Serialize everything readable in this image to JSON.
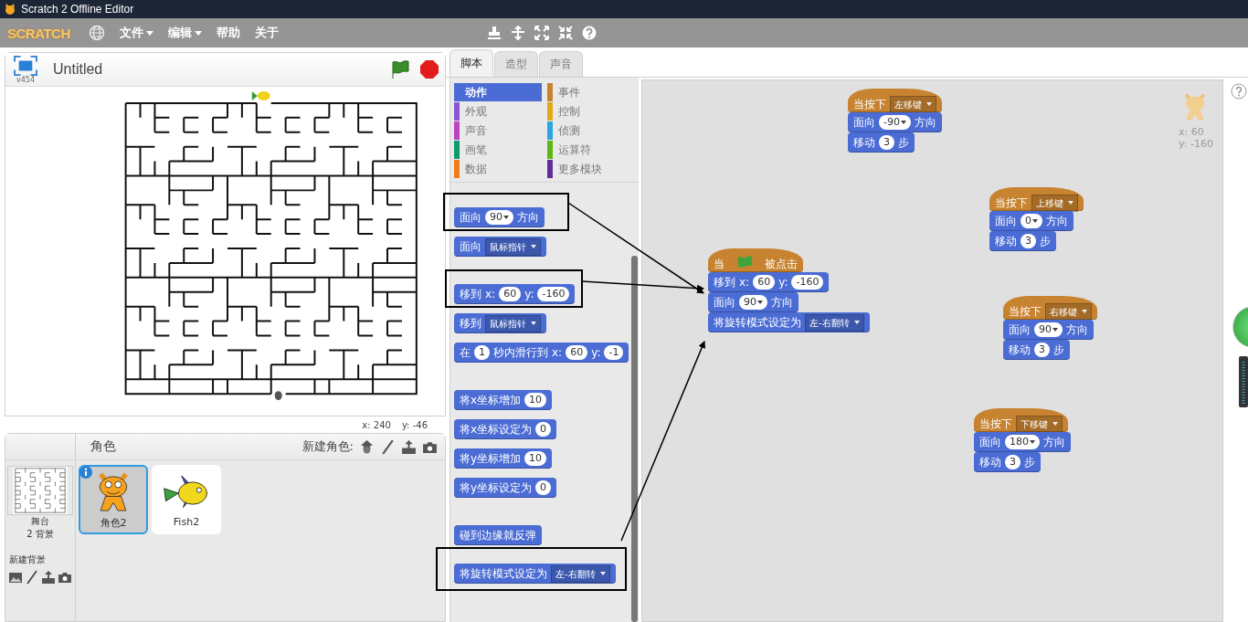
{
  "window": {
    "title": "Scratch 2 Offline Editor"
  },
  "menu": {
    "logo": "SCRATCH",
    "items": [
      {
        "label": "文件",
        "dropdown": true
      },
      {
        "label": "编辑",
        "dropdown": true
      },
      {
        "label": "帮助",
        "dropdown": false
      },
      {
        "label": "关于",
        "dropdown": false
      }
    ]
  },
  "stage": {
    "title": "Untitled",
    "version": "v454",
    "mouse_x": "x: 240",
    "mouse_y": "y: -46"
  },
  "sprites_panel": {
    "title": "角色",
    "new_sprite_label": "新建角色:",
    "stage_label": "舞台",
    "backdrop_count": "2 背景",
    "new_backdrop_label": "新建背景",
    "sprites": [
      {
        "name": "角色2",
        "kind": "cat",
        "selected": true
      },
      {
        "name": "Fish2",
        "kind": "fish",
        "selected": false
      }
    ]
  },
  "tabs": [
    {
      "label": "脚本",
      "selected": true
    },
    {
      "label": "造型",
      "selected": false
    },
    {
      "label": "声音",
      "selected": false
    }
  ],
  "categories": [
    {
      "label": "动作",
      "color": "#4a6cd4",
      "selected": true
    },
    {
      "label": "事件",
      "color": "#c88330",
      "selected": false
    },
    {
      "label": "外观",
      "color": "#8a55d7",
      "selected": false
    },
    {
      "label": "控制",
      "color": "#e1a91a",
      "selected": false
    },
    {
      "label": "声音",
      "color": "#bb42c3",
      "selected": false
    },
    {
      "label": "侦测",
      "color": "#2ca5e2",
      "selected": false
    },
    {
      "label": "画笔",
      "color": "#0e9a6c",
      "selected": false
    },
    {
      "label": "运算符",
      "color": "#5cb712",
      "selected": false
    },
    {
      "label": "数据",
      "color": "#ee7d16",
      "selected": false
    },
    {
      "label": "更多模块",
      "color": "#632d99",
      "selected": false
    }
  ],
  "palette_groups": [
    [
      {
        "color": "#4a6cd4",
        "kind": "stack",
        "parts": [
          {
            "kind": "text",
            "text": "面向"
          },
          {
            "kind": "number",
            "text": "90",
            "dropdown": true
          },
          {
            "kind": "text",
            "text": "方向"
          }
        ]
      },
      {
        "color": "#4a6cd4",
        "kind": "stack",
        "parts": [
          {
            "kind": "text",
            "text": "面向"
          },
          {
            "kind": "menu",
            "text": "鼠标指针"
          }
        ]
      }
    ],
    [
      {
        "color": "#4a6cd4",
        "kind": "stack",
        "parts": [
          {
            "kind": "text",
            "text": "移到"
          },
          {
            "kind": "text",
            "text": "x:"
          },
          {
            "kind": "number",
            "text": "60",
            "dropdown": false
          },
          {
            "kind": "text",
            "text": "y:"
          },
          {
            "kind": "number",
            "text": "-160",
            "dropdown": false
          }
        ]
      },
      {
        "color": "#4a6cd4",
        "kind": "stack",
        "parts": [
          {
            "kind": "text",
            "text": "移到"
          },
          {
            "kind": "menu",
            "text": "鼠标指针"
          }
        ]
      },
      {
        "color": "#4a6cd4",
        "kind": "stack",
        "parts": [
          {
            "kind": "text",
            "text": "在"
          },
          {
            "kind": "number",
            "text": "1",
            "dropdown": false
          },
          {
            "kind": "text",
            "text": "秒内滑行到"
          },
          {
            "kind": "text",
            "text": "x:"
          },
          {
            "kind": "number",
            "text": "60",
            "dropdown": false
          },
          {
            "kind": "text",
            "text": "y:"
          },
          {
            "kind": "number",
            "text": "-1",
            "dropdown": false
          }
        ]
      }
    ],
    [
      {
        "color": "#4a6cd4",
        "kind": "stack",
        "parts": [
          {
            "kind": "text",
            "text": "将x坐标增加"
          },
          {
            "kind": "number",
            "text": "10",
            "dropdown": false
          }
        ]
      },
      {
        "color": "#4a6cd4",
        "kind": "stack",
        "parts": [
          {
            "kind": "text",
            "text": "将x坐标设定为"
          },
          {
            "kind": "number",
            "text": "0",
            "dropdown": false
          }
        ]
      },
      {
        "color": "#4a6cd4",
        "kind": "stack",
        "parts": [
          {
            "kind": "text",
            "text": "将y坐标增加"
          },
          {
            "kind": "number",
            "text": "10",
            "dropdown": false
          }
        ]
      },
      {
        "color": "#4a6cd4",
        "kind": "stack",
        "parts": [
          {
            "kind": "text",
            "text": "将y坐标设定为"
          },
          {
            "kind": "number",
            "text": "0",
            "dropdown": false
          }
        ]
      }
    ],
    [
      {
        "color": "#4a6cd4",
        "kind": "stack",
        "parts": [
          {
            "kind": "text",
            "text": "碰到边缘就反弹"
          }
        ]
      }
    ],
    [
      {
        "color": "#4a6cd4",
        "kind": "stack",
        "parts": [
          {
            "kind": "text",
            "text": "将旋转模式设定为"
          },
          {
            "kind": "menu",
            "text": "左-右翻转"
          }
        ]
      }
    ]
  ],
  "scripts": [
    [
      {
        "color": "#c88330",
        "kind": "hat",
        "parts": [
          {
            "kind": "text",
            "text": "当按下"
          },
          {
            "kind": "menu",
            "text": "左移键"
          }
        ]
      },
      {
        "color": "#4a6cd4",
        "kind": "stack",
        "parts": [
          {
            "kind": "text",
            "text": "面向"
          },
          {
            "kind": "number",
            "text": "-90",
            "dropdown": true
          },
          {
            "kind": "text",
            "text": "方向"
          }
        ]
      },
      {
        "color": "#4a6cd4",
        "kind": "stack",
        "parts": [
          {
            "kind": "text",
            "text": "移动"
          },
          {
            "kind": "number",
            "text": "3",
            "dropdown": false
          },
          {
            "kind": "text",
            "text": "步"
          }
        ]
      }
    ],
    [
      {
        "color": "#c88330",
        "kind": "hat",
        "parts": [
          {
            "kind": "text",
            "text": "当按下"
          },
          {
            "kind": "menu",
            "text": "上移键"
          }
        ]
      },
      {
        "color": "#4a6cd4",
        "kind": "stack",
        "parts": [
          {
            "kind": "text",
            "text": "面向"
          },
          {
            "kind": "number",
            "text": "0",
            "dropdown": true
          },
          {
            "kind": "text",
            "text": "方向"
          }
        ]
      },
      {
        "color": "#4a6cd4",
        "kind": "stack",
        "parts": [
          {
            "kind": "text",
            "text": "移动"
          },
          {
            "kind": "number",
            "text": "3",
            "dropdown": false
          },
          {
            "kind": "text",
            "text": "步"
          }
        ]
      }
    ],
    [
      {
        "color": "#c88330",
        "kind": "hat",
        "parts": [
          {
            "kind": "text",
            "text": "当"
          },
          {
            "kind": "flag"
          },
          {
            "kind": "text",
            "text": "被点击"
          }
        ]
      },
      {
        "color": "#4a6cd4",
        "kind": "stack",
        "parts": [
          {
            "kind": "text",
            "text": "移到"
          },
          {
            "kind": "text",
            "text": "x:"
          },
          {
            "kind": "number",
            "text": "60",
            "dropdown": false
          },
          {
            "kind": "text",
            "text": "y:"
          },
          {
            "kind": "number",
            "text": "-160",
            "dropdown": false
          }
        ]
      },
      {
        "color": "#4a6cd4",
        "kind": "stack",
        "parts": [
          {
            "kind": "text",
            "text": "面向"
          },
          {
            "kind": "number",
            "text": "90",
            "dropdown": true
          },
          {
            "kind": "text",
            "text": "方向"
          }
        ]
      },
      {
        "color": "#4a6cd4",
        "kind": "stack",
        "parts": [
          {
            "kind": "text",
            "text": "将旋转模式设定为"
          },
          {
            "kind": "menu",
            "text": "左-右翻转"
          }
        ]
      }
    ],
    [
      {
        "color": "#c88330",
        "kind": "hat",
        "parts": [
          {
            "kind": "text",
            "text": "当按下"
          },
          {
            "kind": "menu",
            "text": "右移键"
          }
        ]
      },
      {
        "color": "#4a6cd4",
        "kind": "stack",
        "parts": [
          {
            "kind": "text",
            "text": "面向"
          },
          {
            "kind": "number",
            "text": "90",
            "dropdown": true
          },
          {
            "kind": "text",
            "text": "方向"
          }
        ]
      },
      {
        "color": "#4a6cd4",
        "kind": "stack",
        "parts": [
          {
            "kind": "text",
            "text": "移动"
          },
          {
            "kind": "number",
            "text": "3",
            "dropdown": false
          },
          {
            "kind": "text",
            "text": "步"
          }
        ]
      }
    ],
    [
      {
        "color": "#c88330",
        "kind": "hat",
        "parts": [
          {
            "kind": "text",
            "text": "当按下"
          },
          {
            "kind": "menu",
            "text": "下移键"
          }
        ]
      },
      {
        "color": "#4a6cd4",
        "kind": "stack",
        "parts": [
          {
            "kind": "text",
            "text": "面向"
          },
          {
            "kind": "number",
            "text": "180",
            "dropdown": true
          },
          {
            "kind": "text",
            "text": "方向"
          }
        ]
      },
      {
        "color": "#4a6cd4",
        "kind": "stack",
        "parts": [
          {
            "kind": "text",
            "text": "移动"
          },
          {
            "kind": "number",
            "text": "3",
            "dropdown": false
          },
          {
            "kind": "text",
            "text": "步"
          }
        ]
      }
    ]
  ],
  "sprite_info": {
    "x": "x: 60",
    "y": "y: -160"
  }
}
